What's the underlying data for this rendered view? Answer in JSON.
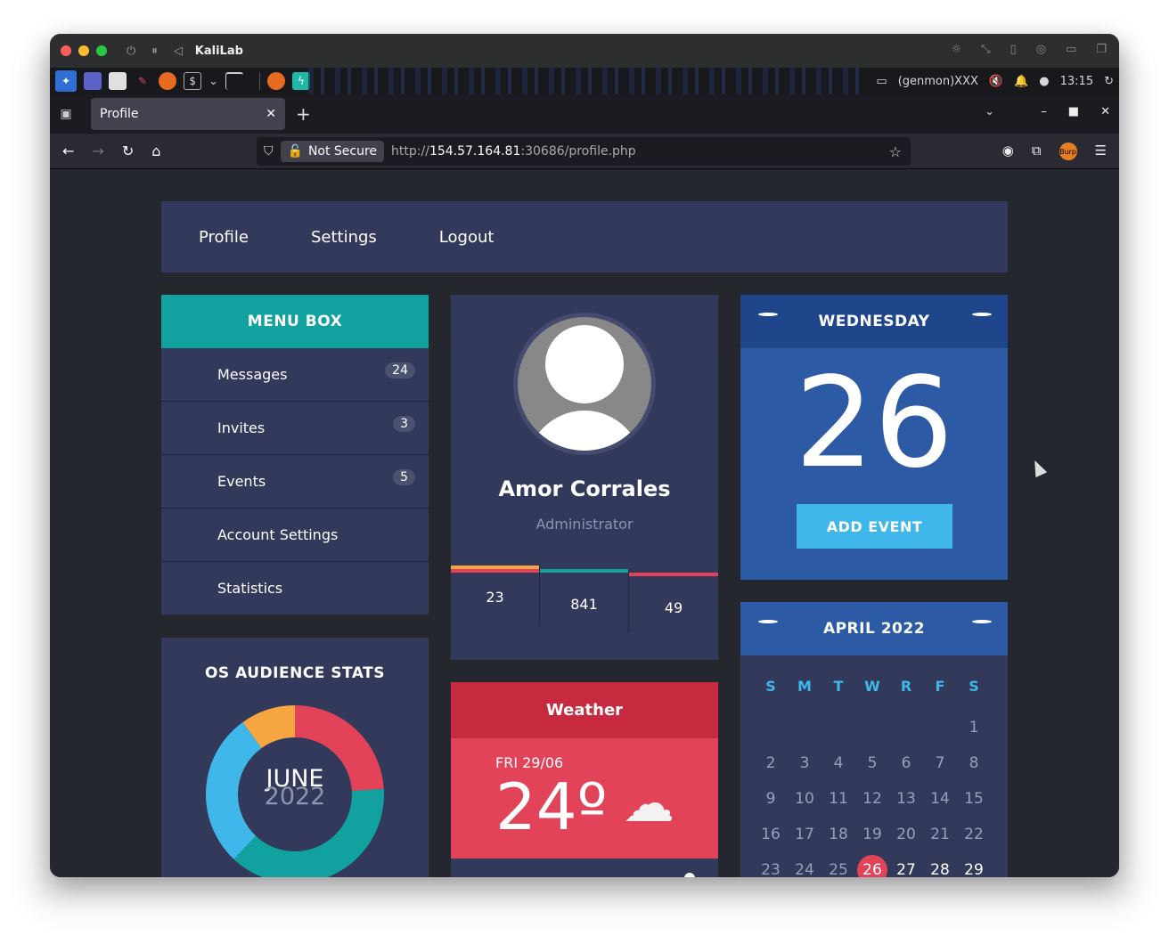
{
  "mac": {
    "title": "KaliLab"
  },
  "kali_panel": {
    "genmon": "(genmon)XXX",
    "clock": "13:15"
  },
  "browser": {
    "tab_title": "Profile",
    "new_tab": "+",
    "url_security": "Not Secure",
    "url_scheme": "http://",
    "url_host": "154.57.164.81",
    "url_rest": ":30686/profile.php",
    "burp_label": "Burp"
  },
  "nav": {
    "items": [
      {
        "label": "Profile"
      },
      {
        "label": "Settings"
      },
      {
        "label": "Logout"
      }
    ]
  },
  "menu_box": {
    "title": "MENU BOX",
    "items": [
      {
        "label": "Messages",
        "badge": "24"
      },
      {
        "label": "Invites",
        "badge": "3"
      },
      {
        "label": "Events",
        "badge": "5"
      },
      {
        "label": "Account Settings",
        "badge": ""
      },
      {
        "label": "Statistics",
        "badge": ""
      }
    ]
  },
  "profile": {
    "name": "Amor Corrales",
    "role": "Administrator",
    "stats": [
      {
        "value": "23",
        "colors": [
          "#f6a640",
          "#e34359"
        ]
      },
      {
        "value": "841",
        "colors": [
          "#11a19f"
        ]
      },
      {
        "value": "49",
        "colors": [
          "#e34359"
        ]
      }
    ]
  },
  "weather": {
    "title": "Weather",
    "date": "FRI 29/06",
    "temp": "24º",
    "icon": "cloud-icon"
  },
  "date_widget": {
    "day_name": "WEDNESDAY",
    "day_number": "26",
    "button": "ADD EVENT"
  },
  "calendar": {
    "title": "APRIL 2022",
    "weekdays": [
      "S",
      "M",
      "T",
      "W",
      "R",
      "F",
      "S"
    ],
    "leading_blanks": 6,
    "days": [
      "1",
      "2",
      "3",
      "4",
      "5",
      "6",
      "7",
      "8",
      "9",
      "10",
      "11",
      "12",
      "13",
      "14",
      "15",
      "16",
      "17",
      "18",
      "19",
      "20",
      "21",
      "22",
      "23",
      "24",
      "25",
      "26",
      "27",
      "28",
      "29"
    ],
    "today": "26"
  },
  "os_stats": {
    "title": "OS AUDIENCE STATS",
    "month": "JUNE",
    "year": "2022",
    "segments": [
      {
        "share": 0.24,
        "color": "#e34359"
      },
      {
        "share": 0.38,
        "color": "#11a19f"
      },
      {
        "share": 0.28,
        "color": "#3fb7ea"
      },
      {
        "share": 0.1,
        "color": "#f6a640"
      }
    ]
  },
  "colors": {
    "page_bg": "#24272e",
    "card_bg": "#32395a",
    "teal": "#11a19f",
    "blue": "#2c5aa4",
    "red": "#e34359",
    "light_blue": "#3fb7ea"
  }
}
